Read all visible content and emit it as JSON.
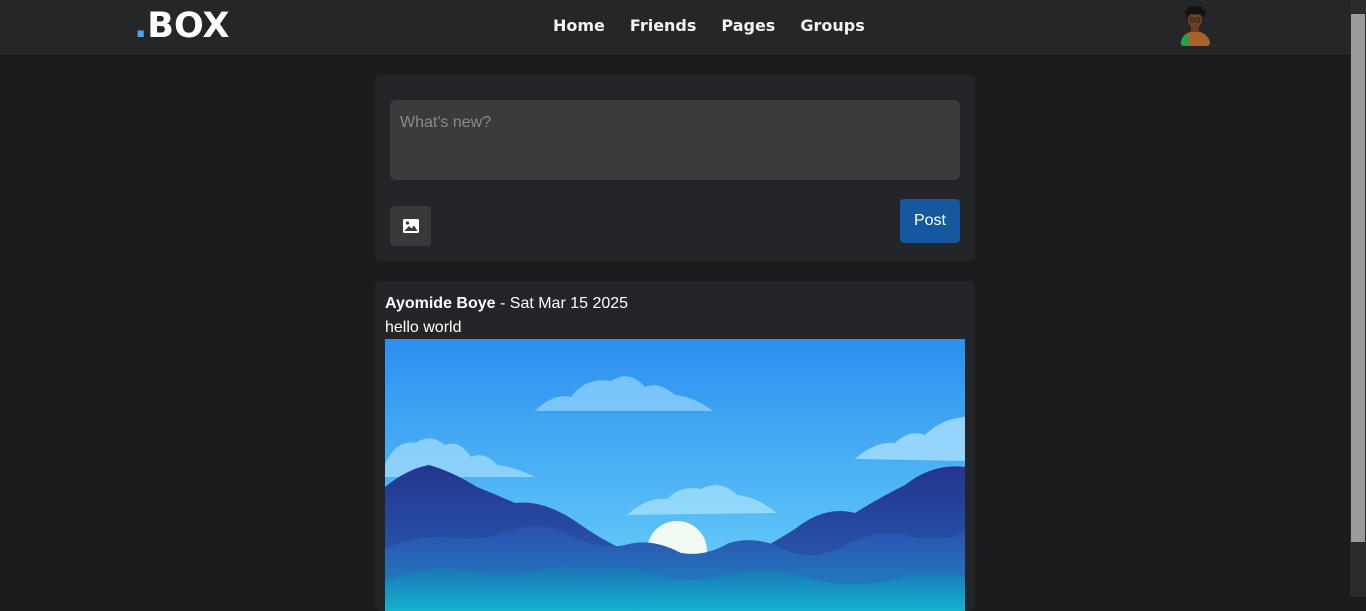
{
  "header": {
    "logo_dot": ".",
    "logo_text": "BOX",
    "nav": [
      "Home",
      "Friends",
      "Pages",
      "Groups"
    ]
  },
  "composer": {
    "placeholder": "What's new?",
    "post_label": "Post",
    "image_icon": "image-icon"
  },
  "post": {
    "author": "Ayomide Boye",
    "separator": " - ",
    "date": "Sat Mar 15 2025",
    "body": "hello world",
    "image": "mountain-landscape-illustration"
  },
  "colors": {
    "background": "#1b1c1e",
    "navbar": "#252628",
    "card": "#242528",
    "accent": "#1558a0",
    "logo_dot": "#4ca3e6"
  }
}
